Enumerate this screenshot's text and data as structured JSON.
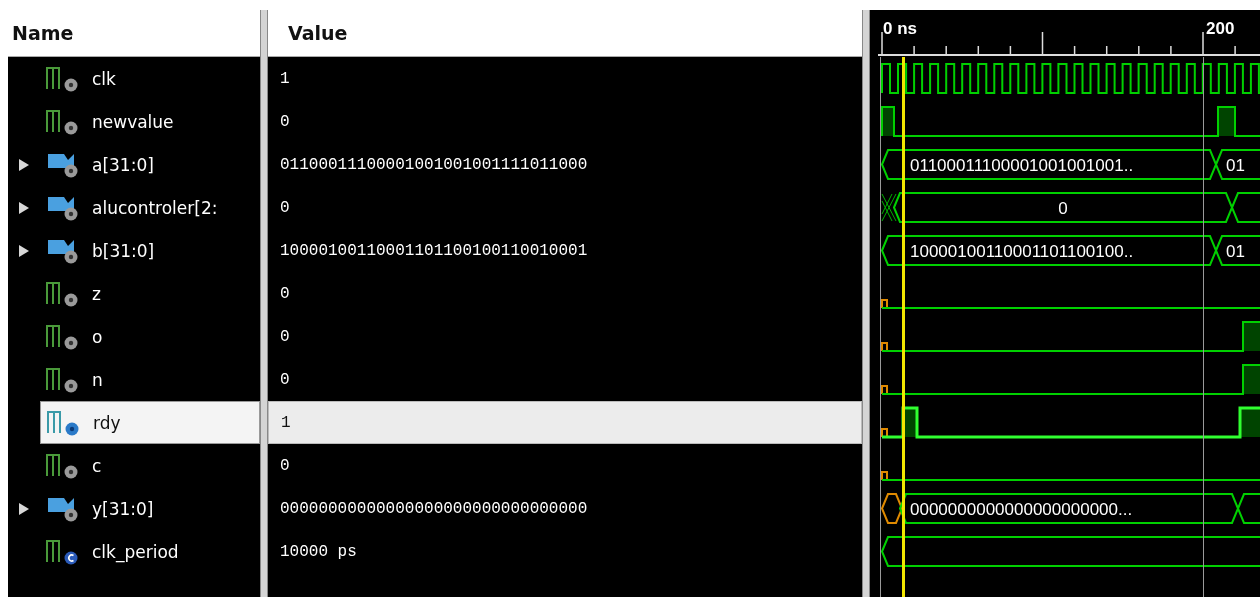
{
  "columns": {
    "name": "Name",
    "value": "Value"
  },
  "ruler": {
    "labels": [
      "0 ns",
      "200"
    ]
  },
  "signals": [
    {
      "name": "clk",
      "kind": "bit",
      "value": "1",
      "selected": false
    },
    {
      "name": "newvalue",
      "kind": "bit",
      "value": "0",
      "selected": false
    },
    {
      "name": "a[31:0]",
      "kind": "bus",
      "expanded": false,
      "value": "01100011100001001001001111011000",
      "selected": false,
      "wave_labels": [
        "01100011100001001001001..",
        "01"
      ]
    },
    {
      "name": "alucontroler[2:",
      "kind": "bus",
      "expanded": false,
      "value": "0",
      "selected": false,
      "wave_labels": [
        "0"
      ]
    },
    {
      "name": "b[31:0]",
      "kind": "bus",
      "expanded": false,
      "value": "10000100110001101100100110010001",
      "selected": false,
      "wave_labels": [
        "10000100110001101100100..",
        "01"
      ]
    },
    {
      "name": "z",
      "kind": "bit",
      "value": "0",
      "selected": false
    },
    {
      "name": "o",
      "kind": "bit",
      "value": "0",
      "selected": false
    },
    {
      "name": "n",
      "kind": "bit",
      "value": "0",
      "selected": false
    },
    {
      "name": "rdy",
      "kind": "bit",
      "value": "1",
      "selected": true
    },
    {
      "name": "c",
      "kind": "bit",
      "value": "0",
      "selected": false
    },
    {
      "name": "y[31:0]",
      "kind": "bus",
      "expanded": false,
      "value": "00000000000000000000000000000000",
      "selected": false,
      "wave_labels": [
        "0000000000000000000000..."
      ]
    },
    {
      "name": "clk_period",
      "kind": "const",
      "value": "10000 ps",
      "selected": false
    }
  ]
}
